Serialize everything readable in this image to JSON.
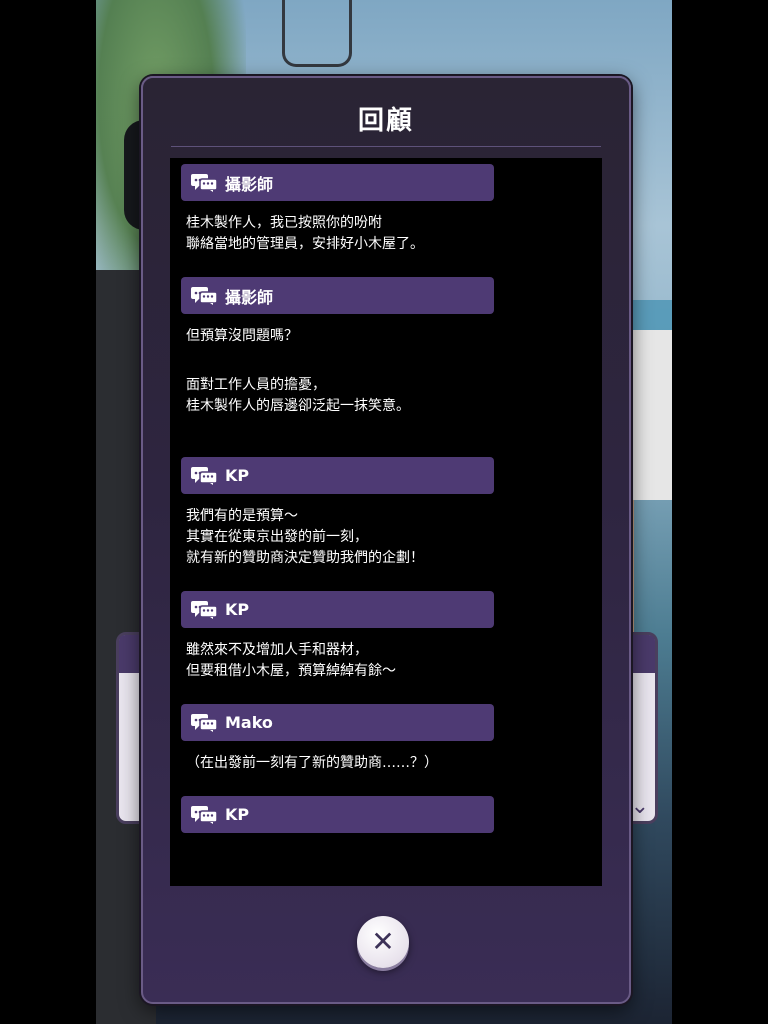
{
  "panel": {
    "title": "回顧",
    "close_icon": "close-icon"
  },
  "entries": [
    {
      "speaker": "攝影師",
      "lines": [
        "桂木製作人，我已按照你的吩咐",
        "聯絡當地的管理員，安排好小木屋了。"
      ]
    },
    {
      "speaker": "攝影師",
      "lines": [
        "但預算沒問題嗎？"
      ]
    },
    {
      "speaker": "",
      "lines": [
        "面對工作人員的擔憂，",
        "桂木製作人的唇邊卻泛起一抹笑意。"
      ]
    },
    {
      "speaker": "KP",
      "lines": [
        "我們有的是預算～",
        "其實在從東京出發的前一刻，",
        "就有新的贊助商決定贊助我們的企劃！"
      ]
    },
    {
      "speaker": "KP",
      "lines": [
        "雖然來不及增加人手和器材，",
        "但要租借小木屋，預算綽綽有餘～"
      ]
    },
    {
      "speaker": "Mako",
      "lines": [
        "（在出發前一刻有了新的贊助商……？）"
      ]
    },
    {
      "speaker": "KP",
      "lines": []
    }
  ],
  "colors": {
    "speaker_bar": "#4e3a74",
    "panel_bg": "#2e2540",
    "log_bg": "#000000"
  }
}
